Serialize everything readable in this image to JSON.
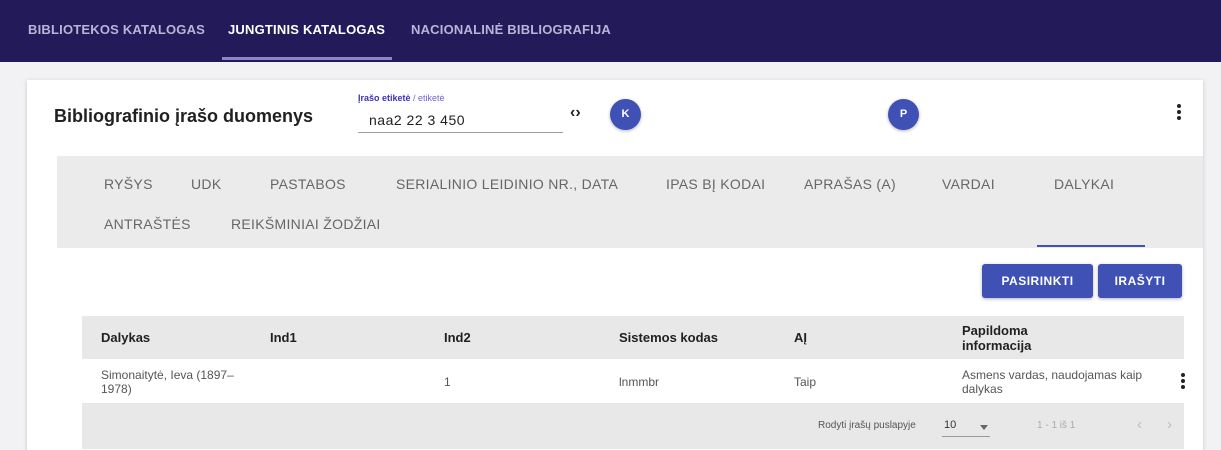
{
  "topnav": {
    "tabs": [
      {
        "label": "BIBLIOTEKOS KATALOGAS"
      },
      {
        "label": "JUNGTINIS KATALOGAS"
      },
      {
        "label": "NACIONALINĖ BIBLIOGRAFIJA"
      }
    ],
    "active_index": 1
  },
  "card": {
    "title": "Bibliografinio įrašo duomenys",
    "tag_field": {
      "label_primary": "Įrašo etiketė",
      "label_separator": " / ",
      "label_secondary": "etiketė",
      "value": "naa2 22   3 450"
    },
    "code_icon": "‹›",
    "btn_k": "K",
    "btn_p": "P",
    "section_tabs": [
      "RYŠYS",
      "UDK",
      "PASTABOS",
      "SERIALINIO LEIDINIO NR., DATA",
      "IPAS BĮ KODAI",
      "APRAŠAS (A)",
      "VARDAI",
      "DALYKAI",
      "ANTRAŠTĖS",
      "REIKŠMINIAI ŽODŽIAI"
    ],
    "active_section_tab": "DALYKAI",
    "actions": {
      "select_label": "PASIRINKTI",
      "save_label": "IRAŠYTI"
    }
  },
  "table": {
    "columns": [
      "Dalykas",
      "Ind1",
      "Ind2",
      "Sistemos kodas",
      "AĮ",
      "Papildoma informacija"
    ],
    "rows": [
      {
        "dalykas": "Simonaitytė, Ieva (1897–1978)",
        "ind1": "",
        "ind2": "1",
        "sistemos_kodas": "lnmmbr",
        "ai": "Taip",
        "papildoma": "Asmens vardas, naudojamas kaip dalykas"
      }
    ],
    "footer": {
      "rows_per_page_label": "Rodyti įrašų puslapyje",
      "rows_per_page_value": "10",
      "range": "1 - 1 iš 1",
      "prev_icon": "‹",
      "next_icon": "›"
    }
  },
  "colors": {
    "nav_bg": "#231a5a",
    "accent": "#3f51b5",
    "label_accent": "#3d30b6"
  }
}
